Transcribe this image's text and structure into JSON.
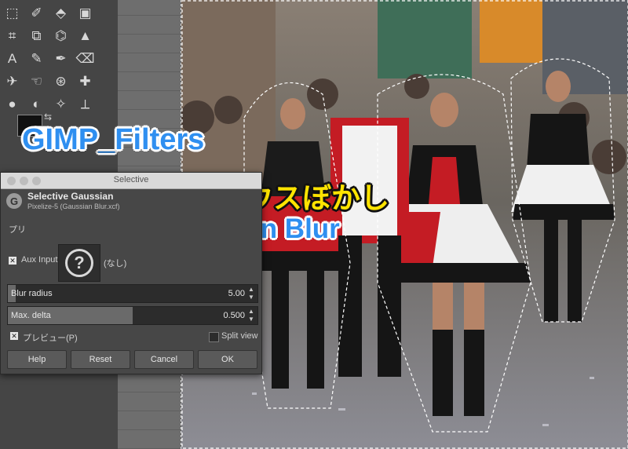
{
  "toolbox": {
    "tools": [
      {
        "name": "select-icon",
        "glyph": "⬚"
      },
      {
        "name": "fuzzy-select-icon",
        "glyph": "✐"
      },
      {
        "name": "transform-icon",
        "glyph": "⬘"
      },
      {
        "name": "warp-icon",
        "glyph": "▣"
      },
      {
        "name": "crop-icon",
        "glyph": "⌗"
      },
      {
        "name": "align-icon",
        "glyph": "⧉"
      },
      {
        "name": "cage-icon",
        "glyph": "⌬"
      },
      {
        "name": "bucket-fill-icon",
        "glyph": "▲"
      },
      {
        "name": "text-icon",
        "glyph": "A"
      },
      {
        "name": "pencil-icon",
        "glyph": "✎"
      },
      {
        "name": "brush-icon",
        "glyph": "✒"
      },
      {
        "name": "eraser-icon",
        "glyph": "⌫"
      },
      {
        "name": "airbrush-icon",
        "glyph": "✈"
      },
      {
        "name": "smudge-icon",
        "glyph": "☜"
      },
      {
        "name": "clone-icon",
        "glyph": "⊛"
      },
      {
        "name": "heal-icon",
        "glyph": "✚"
      },
      {
        "name": "blur-icon",
        "glyph": "●"
      },
      {
        "name": "dodge-icon",
        "glyph": "◐"
      },
      {
        "name": "path-icon",
        "glyph": "✧"
      },
      {
        "name": "measure-icon",
        "glyph": "⟂"
      }
    ]
  },
  "overlay": {
    "title_en": "GIMP_Filters",
    "title_ja": "選択的ガウスぼかし",
    "subtitle_en": "Selective Gaussian Blur"
  },
  "dialog": {
    "window_title": "Selective",
    "filter_name": "Selective Gaussian",
    "filter_sub": "Pixelize-5 (Gaussian Blur.xcf)",
    "preset_label": "プリ",
    "aux_input_label": "Aux Input",
    "aux_input_checked": true,
    "aux_input_value": "(なし)",
    "blur_radius": {
      "label": "Blur radius",
      "value": "5.00",
      "fraction": 0.03
    },
    "max_delta": {
      "label": "Max. delta",
      "value": "0.500",
      "fraction": 0.5
    },
    "preview_label": "プレビュー(P)",
    "preview_checked": true,
    "split_view_label": "Split view",
    "split_view_checked": false,
    "buttons": {
      "help": "Help",
      "reset": "Reset",
      "cancel": "Cancel",
      "ok": "OK"
    }
  }
}
